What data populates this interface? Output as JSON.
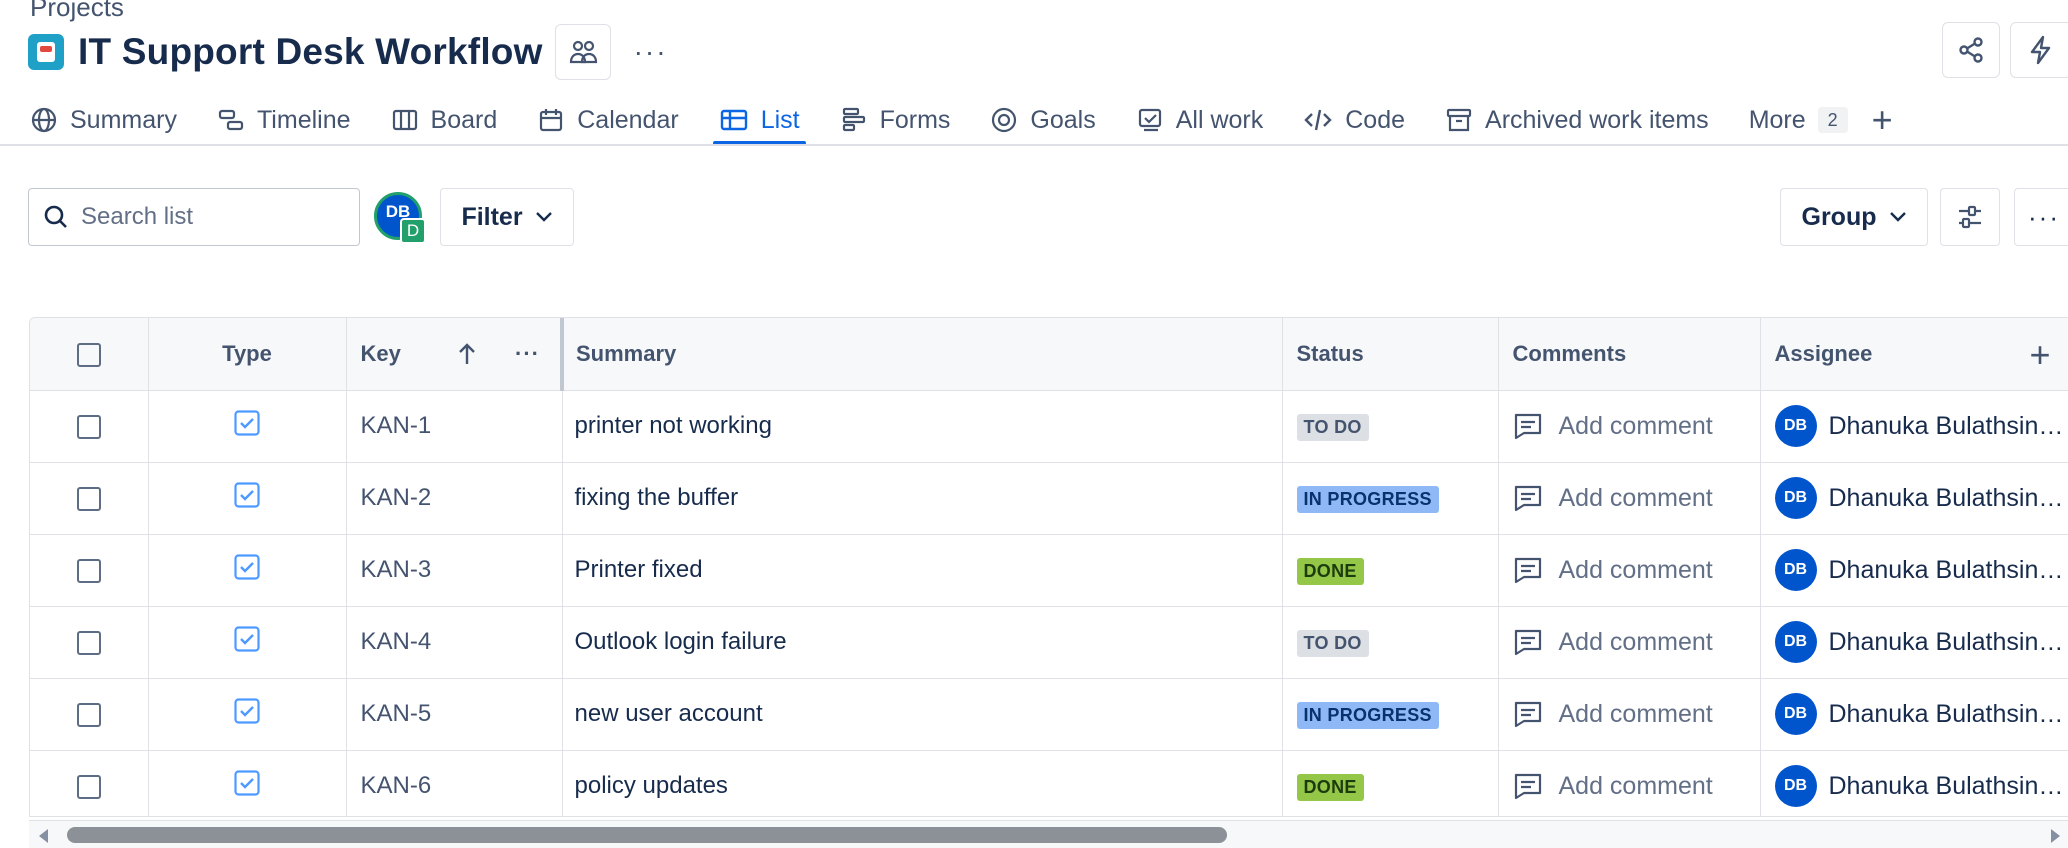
{
  "breadcrumb": "Projects",
  "header": {
    "title": "IT Support Desk Workflow"
  },
  "tabs": [
    {
      "label": "Summary",
      "icon": "globe-icon"
    },
    {
      "label": "Timeline",
      "icon": "timeline-icon"
    },
    {
      "label": "Board",
      "icon": "board-icon"
    },
    {
      "label": "Calendar",
      "icon": "calendar-icon"
    },
    {
      "label": "List",
      "icon": "list-icon",
      "active": true
    },
    {
      "label": "Forms",
      "icon": "forms-icon"
    },
    {
      "label": "Goals",
      "icon": "goals-icon"
    },
    {
      "label": "All work",
      "icon": "all-work-icon"
    },
    {
      "label": "Code",
      "icon": "code-icon"
    },
    {
      "label": "Archived work items",
      "icon": "archive-icon"
    },
    {
      "label": "More",
      "icon": null,
      "count": "2"
    }
  ],
  "toolbar": {
    "search_placeholder": "Search list",
    "avatar_initials": "DB",
    "avatar_sub": "D",
    "filter_label": "Filter",
    "group_label": "Group"
  },
  "table": {
    "headers": {
      "type": "Type",
      "key": "Key",
      "summary": "Summary",
      "status": "Status",
      "comments": "Comments",
      "assignee": "Assignee"
    },
    "rows": [
      {
        "key": "KAN-1",
        "summary": "printer not working",
        "status": "TO DO",
        "comment": "Add comment",
        "assignee_initials": "DB",
        "assignee": "Dhanuka Bulathsing..."
      },
      {
        "key": "KAN-2",
        "summary": "fixing the buffer",
        "status": "IN PROGRESS",
        "comment": "Add comment",
        "assignee_initials": "DB",
        "assignee": "Dhanuka Bulathsing..."
      },
      {
        "key": "KAN-3",
        "summary": "Printer fixed",
        "status": "DONE",
        "comment": "Add comment",
        "assignee_initials": "DB",
        "assignee": "Dhanuka Bulathsing..."
      },
      {
        "key": "KAN-4",
        "summary": "Outlook login failure",
        "status": "TO DO",
        "comment": "Add comment",
        "assignee_initials": "DB",
        "assignee": "Dhanuka Bulathsing..."
      },
      {
        "key": "KAN-5",
        "summary": "new user account",
        "status": "IN PROGRESS",
        "comment": "Add comment",
        "assignee_initials": "DB",
        "assignee": "Dhanuka Bulathsing..."
      },
      {
        "key": "KAN-6",
        "summary": "policy updates",
        "status": "DONE",
        "comment": "Add comment",
        "assignee_initials": "DB",
        "assignee": "Dhanuka Bulathsing..."
      }
    ]
  },
  "colors": {
    "accent": "#0c66e4",
    "status_todo": "#dcdfe4",
    "status_in_progress": "#8fb8f6",
    "status_done": "#94c748",
    "avatar": "#0055cc"
  }
}
